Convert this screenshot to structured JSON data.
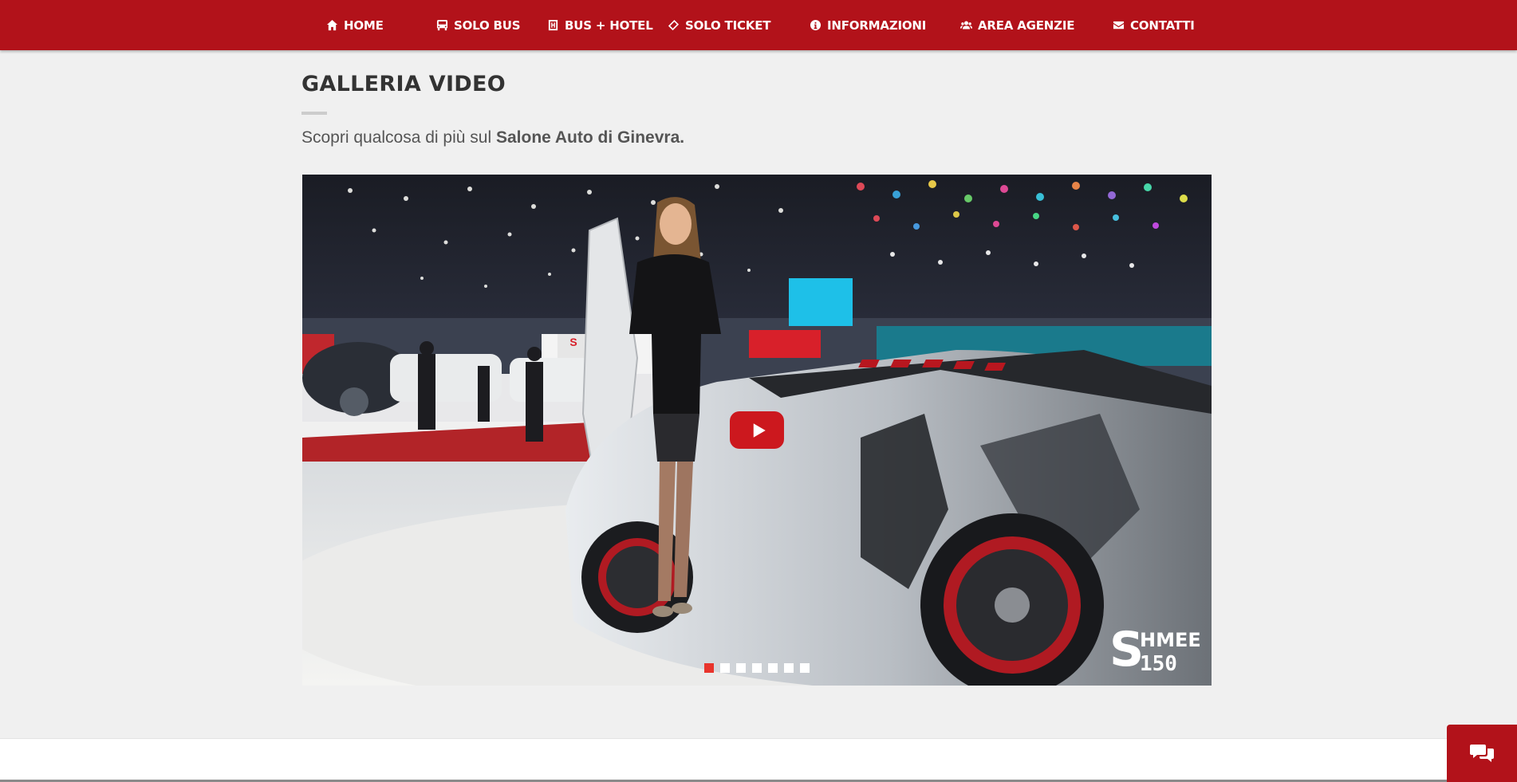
{
  "nav": {
    "items": [
      {
        "label": "HOME",
        "icon": "home-icon"
      },
      {
        "label": "SOLO BUS",
        "icon": "bus-icon"
      },
      {
        "label": "BUS + HOTEL",
        "icon": "hotel-icon"
      },
      {
        "label": "SOLO TICKET",
        "icon": "ticket-icon"
      },
      {
        "label": "INFORMAZIONI",
        "icon": "info-icon"
      },
      {
        "label": "AREA AGENZIE",
        "icon": "users-icon"
      },
      {
        "label": "CONTATTI",
        "icon": "envelope-icon"
      }
    ]
  },
  "page": {
    "title": "GALLERIA VIDEO",
    "subtitle_prefix": "Scopri qualcosa di più sul ",
    "subtitle_bold": "Salone Auto di Ginevra."
  },
  "video": {
    "watermark": "SHMEE150",
    "play_icon": "play-icon",
    "slides_total": 7,
    "active_slide": 1
  },
  "chat": {
    "icon": "chat-icon"
  },
  "colors": {
    "brand_red": "#b2121a",
    "youtube_red": "#cc181e",
    "active_dot": "#e8342c",
    "background": "#f0f0f0"
  }
}
